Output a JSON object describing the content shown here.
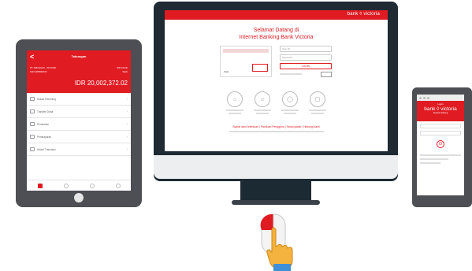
{
  "tablet": {
    "back": "<",
    "title": "Tabungan",
    "account_name": "PT. TABUNGAN - VICTORIA",
    "account_number": "0123 4280000XXX",
    "right_line1": "IDR 0,00.00",
    "right_line2": "Saldo",
    "balance": "IDR 20,002,372.02",
    "menu": [
      "Mutasi Rekening",
      "Transfer Dana",
      "Pembelian",
      "Pembayaran",
      "Histori Transaksi"
    ],
    "chevron": "›"
  },
  "monitor": {
    "logo": "bank ◊ victoria",
    "greeting_line1": "Selamat Datang di",
    "greeting_line2": "Internet Banking Bank Victoria",
    "captcha_label": "Kata",
    "user_placeholder": "User ID",
    "password_placeholder": "Password",
    "login_button": "LOGIN",
    "links": "Syarat dan Ketentuan  |  Panduan Pengguna  |  Tanya jawab  |  Hubungi kami"
  },
  "phone": {
    "small": "Login",
    "logo": "bank ◊ victoria",
    "sub": "Selamat Datang"
  },
  "colors": {
    "accent": "#e01b22",
    "device": "#4d4f54",
    "monitor": "#1f2a33"
  }
}
